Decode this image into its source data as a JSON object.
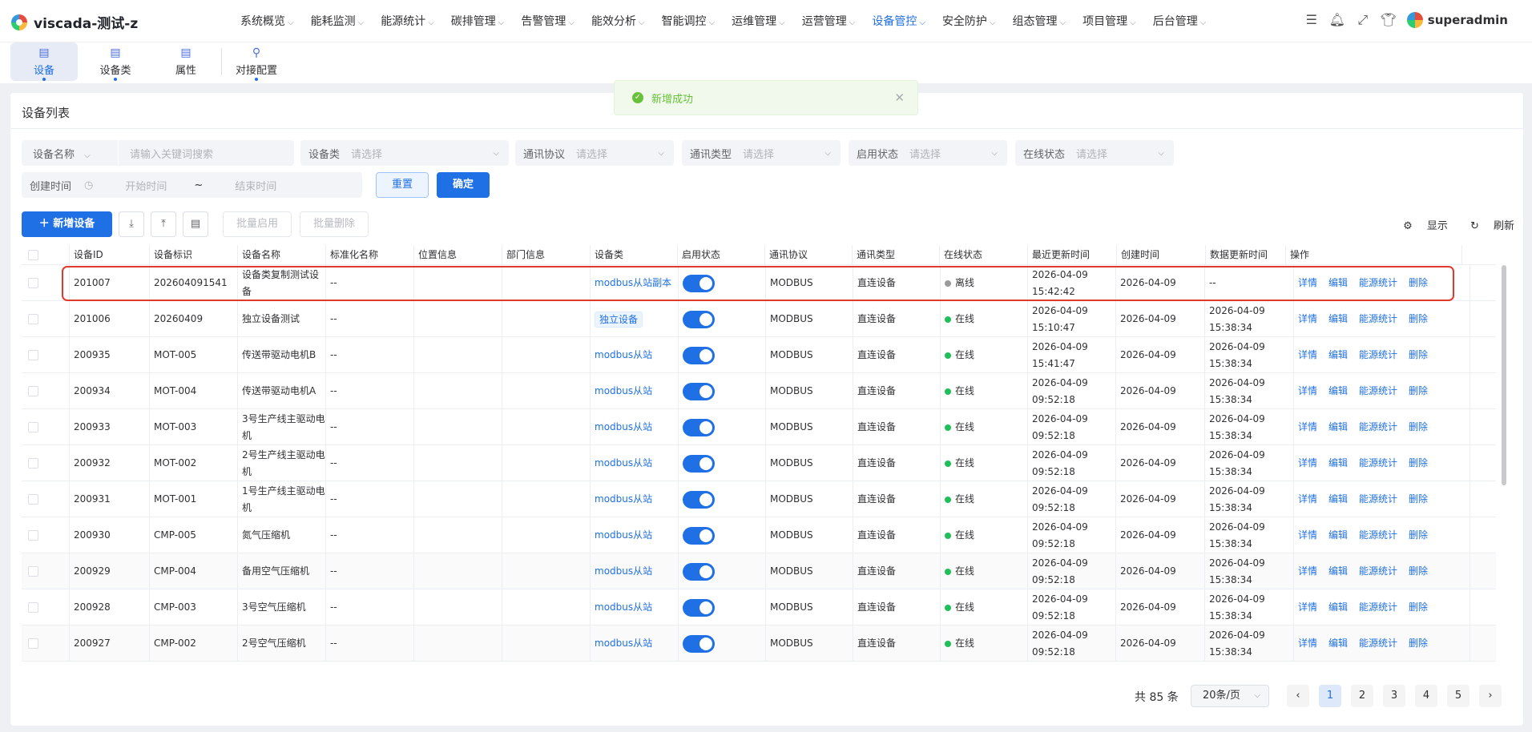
{
  "app": {
    "title": "viscada-测试-z",
    "user": "superadmin"
  },
  "menu": [
    {
      "label": "系统概览"
    },
    {
      "label": "能耗监测"
    },
    {
      "label": "能源统计"
    },
    {
      "label": "碳排管理"
    },
    {
      "label": "告警管理"
    },
    {
      "label": "能效分析"
    },
    {
      "label": "智能调控"
    },
    {
      "label": "运维管理"
    },
    {
      "label": "运营管理"
    },
    {
      "label": "设备管控"
    },
    {
      "label": "安全防护"
    },
    {
      "label": "组态管理"
    },
    {
      "label": "项目管理"
    },
    {
      "label": "后台管理"
    }
  ],
  "subnav": [
    {
      "label": "设备"
    },
    {
      "label": "设备类"
    },
    {
      "label": "属性"
    },
    {
      "label": "对接配置"
    }
  ],
  "toast": {
    "message": "新增成功"
  },
  "page": {
    "title": "设备列表"
  },
  "filters": {
    "name_label": "设备名称",
    "name_placeholder": "请输入关键词搜索",
    "class_label": "设备类",
    "protocol_label": "通讯协议",
    "comm_label": "通讯类型",
    "enable_label": "启用状态",
    "online_label": "在线状态",
    "select_placeholder": "请选择",
    "time_label": "创建时间",
    "start_placeholder": "开始时间",
    "end_placeholder": "结束时间",
    "tilde": "~",
    "reset": "重置",
    "confirm": "确定"
  },
  "toolbar": {
    "add": "新增设备",
    "batch_enable": "批量启用",
    "batch_delete": "批量删除",
    "display": "显示",
    "refresh": "刷新"
  },
  "table": {
    "headers": [
      "设备ID",
      "设备标识",
      "设备名称",
      "标准化名称",
      "位置信息",
      "部门信息",
      "设备类",
      "启用状态",
      "通讯协议",
      "通讯类型",
      "在线状态",
      "最近更新时间",
      "创建时间",
      "数据更新时间",
      "操作"
    ],
    "actions": [
      "详情",
      "编辑",
      "能源统计",
      "删除"
    ],
    "rows": [
      {
        "id": "201007",
        "code": "202604091541",
        "name": "设备类复制测试设备",
        "std": "--",
        "cls": "modbus从站副本",
        "cls_tag": false,
        "protocol": "MODBUS",
        "comm": "直连设备",
        "status": "离线",
        "online": false,
        "last": "2026-04-09 15:42:42",
        "created": "2026-04-09",
        "data_time": "--"
      },
      {
        "id": "201006",
        "code": "20260409",
        "name": "独立设备测试",
        "std": "--",
        "cls": "独立设备",
        "cls_tag": true,
        "protocol": "MODBUS",
        "comm": "直连设备",
        "status": "在线",
        "online": true,
        "last": "2026-04-09 15:10:47",
        "created": "2026-04-09",
        "data_time": "2026-04-09 15:38:34"
      },
      {
        "id": "200935",
        "code": "MOT-005",
        "name": "传送带驱动电机B",
        "std": "--",
        "cls": "modbus从站",
        "cls_tag": false,
        "protocol": "MODBUS",
        "comm": "直连设备",
        "status": "在线",
        "online": true,
        "last": "2026-04-09 15:41:47",
        "created": "2026-04-09",
        "data_time": "2026-04-09 15:38:34"
      },
      {
        "id": "200934",
        "code": "MOT-004",
        "name": "传送带驱动电机A",
        "std": "--",
        "cls": "modbus从站",
        "cls_tag": false,
        "protocol": "MODBUS",
        "comm": "直连设备",
        "status": "在线",
        "online": true,
        "last": "2026-04-09 09:52:18",
        "created": "2026-04-09",
        "data_time": "2026-04-09 15:38:34"
      },
      {
        "id": "200933",
        "code": "MOT-003",
        "name": "3号生产线主驱动电机",
        "std": "--",
        "cls": "modbus从站",
        "cls_tag": false,
        "protocol": "MODBUS",
        "comm": "直连设备",
        "status": "在线",
        "online": true,
        "last": "2026-04-09 09:52:18",
        "created": "2026-04-09",
        "data_time": "2026-04-09 15:38:34"
      },
      {
        "id": "200932",
        "code": "MOT-002",
        "name": "2号生产线主驱动电机",
        "std": "--",
        "cls": "modbus从站",
        "cls_tag": false,
        "protocol": "MODBUS",
        "comm": "直连设备",
        "status": "在线",
        "online": true,
        "last": "2026-04-09 09:52:18",
        "created": "2026-04-09",
        "data_time": "2026-04-09 15:38:34"
      },
      {
        "id": "200931",
        "code": "MOT-001",
        "name": "1号生产线主驱动电机",
        "std": "--",
        "cls": "modbus从站",
        "cls_tag": false,
        "protocol": "MODBUS",
        "comm": "直连设备",
        "status": "在线",
        "online": true,
        "last": "2026-04-09 09:52:18",
        "created": "2026-04-09",
        "data_time": "2026-04-09 15:38:34"
      },
      {
        "id": "200930",
        "code": "CMP-005",
        "name": "氮气压缩机",
        "std": "--",
        "cls": "modbus从站",
        "cls_tag": false,
        "protocol": "MODBUS",
        "comm": "直连设备",
        "status": "在线",
        "online": true,
        "last": "2026-04-09 09:52:18",
        "created": "2026-04-09",
        "data_time": "2026-04-09 15:38:34"
      },
      {
        "id": "200929",
        "code": "CMP-004",
        "name": "备用空气压缩机",
        "std": "--",
        "cls": "modbus从站",
        "cls_tag": false,
        "protocol": "MODBUS",
        "comm": "直连设备",
        "status": "在线",
        "online": true,
        "last": "2026-04-09 09:52:18",
        "created": "2026-04-09",
        "data_time": "2026-04-09 15:38:34"
      },
      {
        "id": "200928",
        "code": "CMP-003",
        "name": "3号空气压缩机",
        "std": "--",
        "cls": "modbus从站",
        "cls_tag": false,
        "protocol": "MODBUS",
        "comm": "直连设备",
        "status": "在线",
        "online": true,
        "last": "2026-04-09 09:52:18",
        "created": "2026-04-09",
        "data_time": "2026-04-09 15:38:34"
      },
      {
        "id": "200927",
        "code": "CMP-002",
        "name": "2号空气压缩机",
        "std": "--",
        "cls": "modbus从站",
        "cls_tag": false,
        "protocol": "MODBUS",
        "comm": "直连设备",
        "status": "在线",
        "online": true,
        "last": "2026-04-09 09:52:18",
        "created": "2026-04-09",
        "data_time": "2026-04-09 15:38:34"
      }
    ]
  },
  "pagination": {
    "total": "共 85 条",
    "size": "20条/页",
    "pages": [
      "1",
      "2",
      "3",
      "4",
      "5"
    ]
  },
  "colors": {
    "primary": "#1f6fe5",
    "online": "#1fbf5a",
    "offline": "#9a9a9a",
    "highlight": "#e03a2c"
  }
}
